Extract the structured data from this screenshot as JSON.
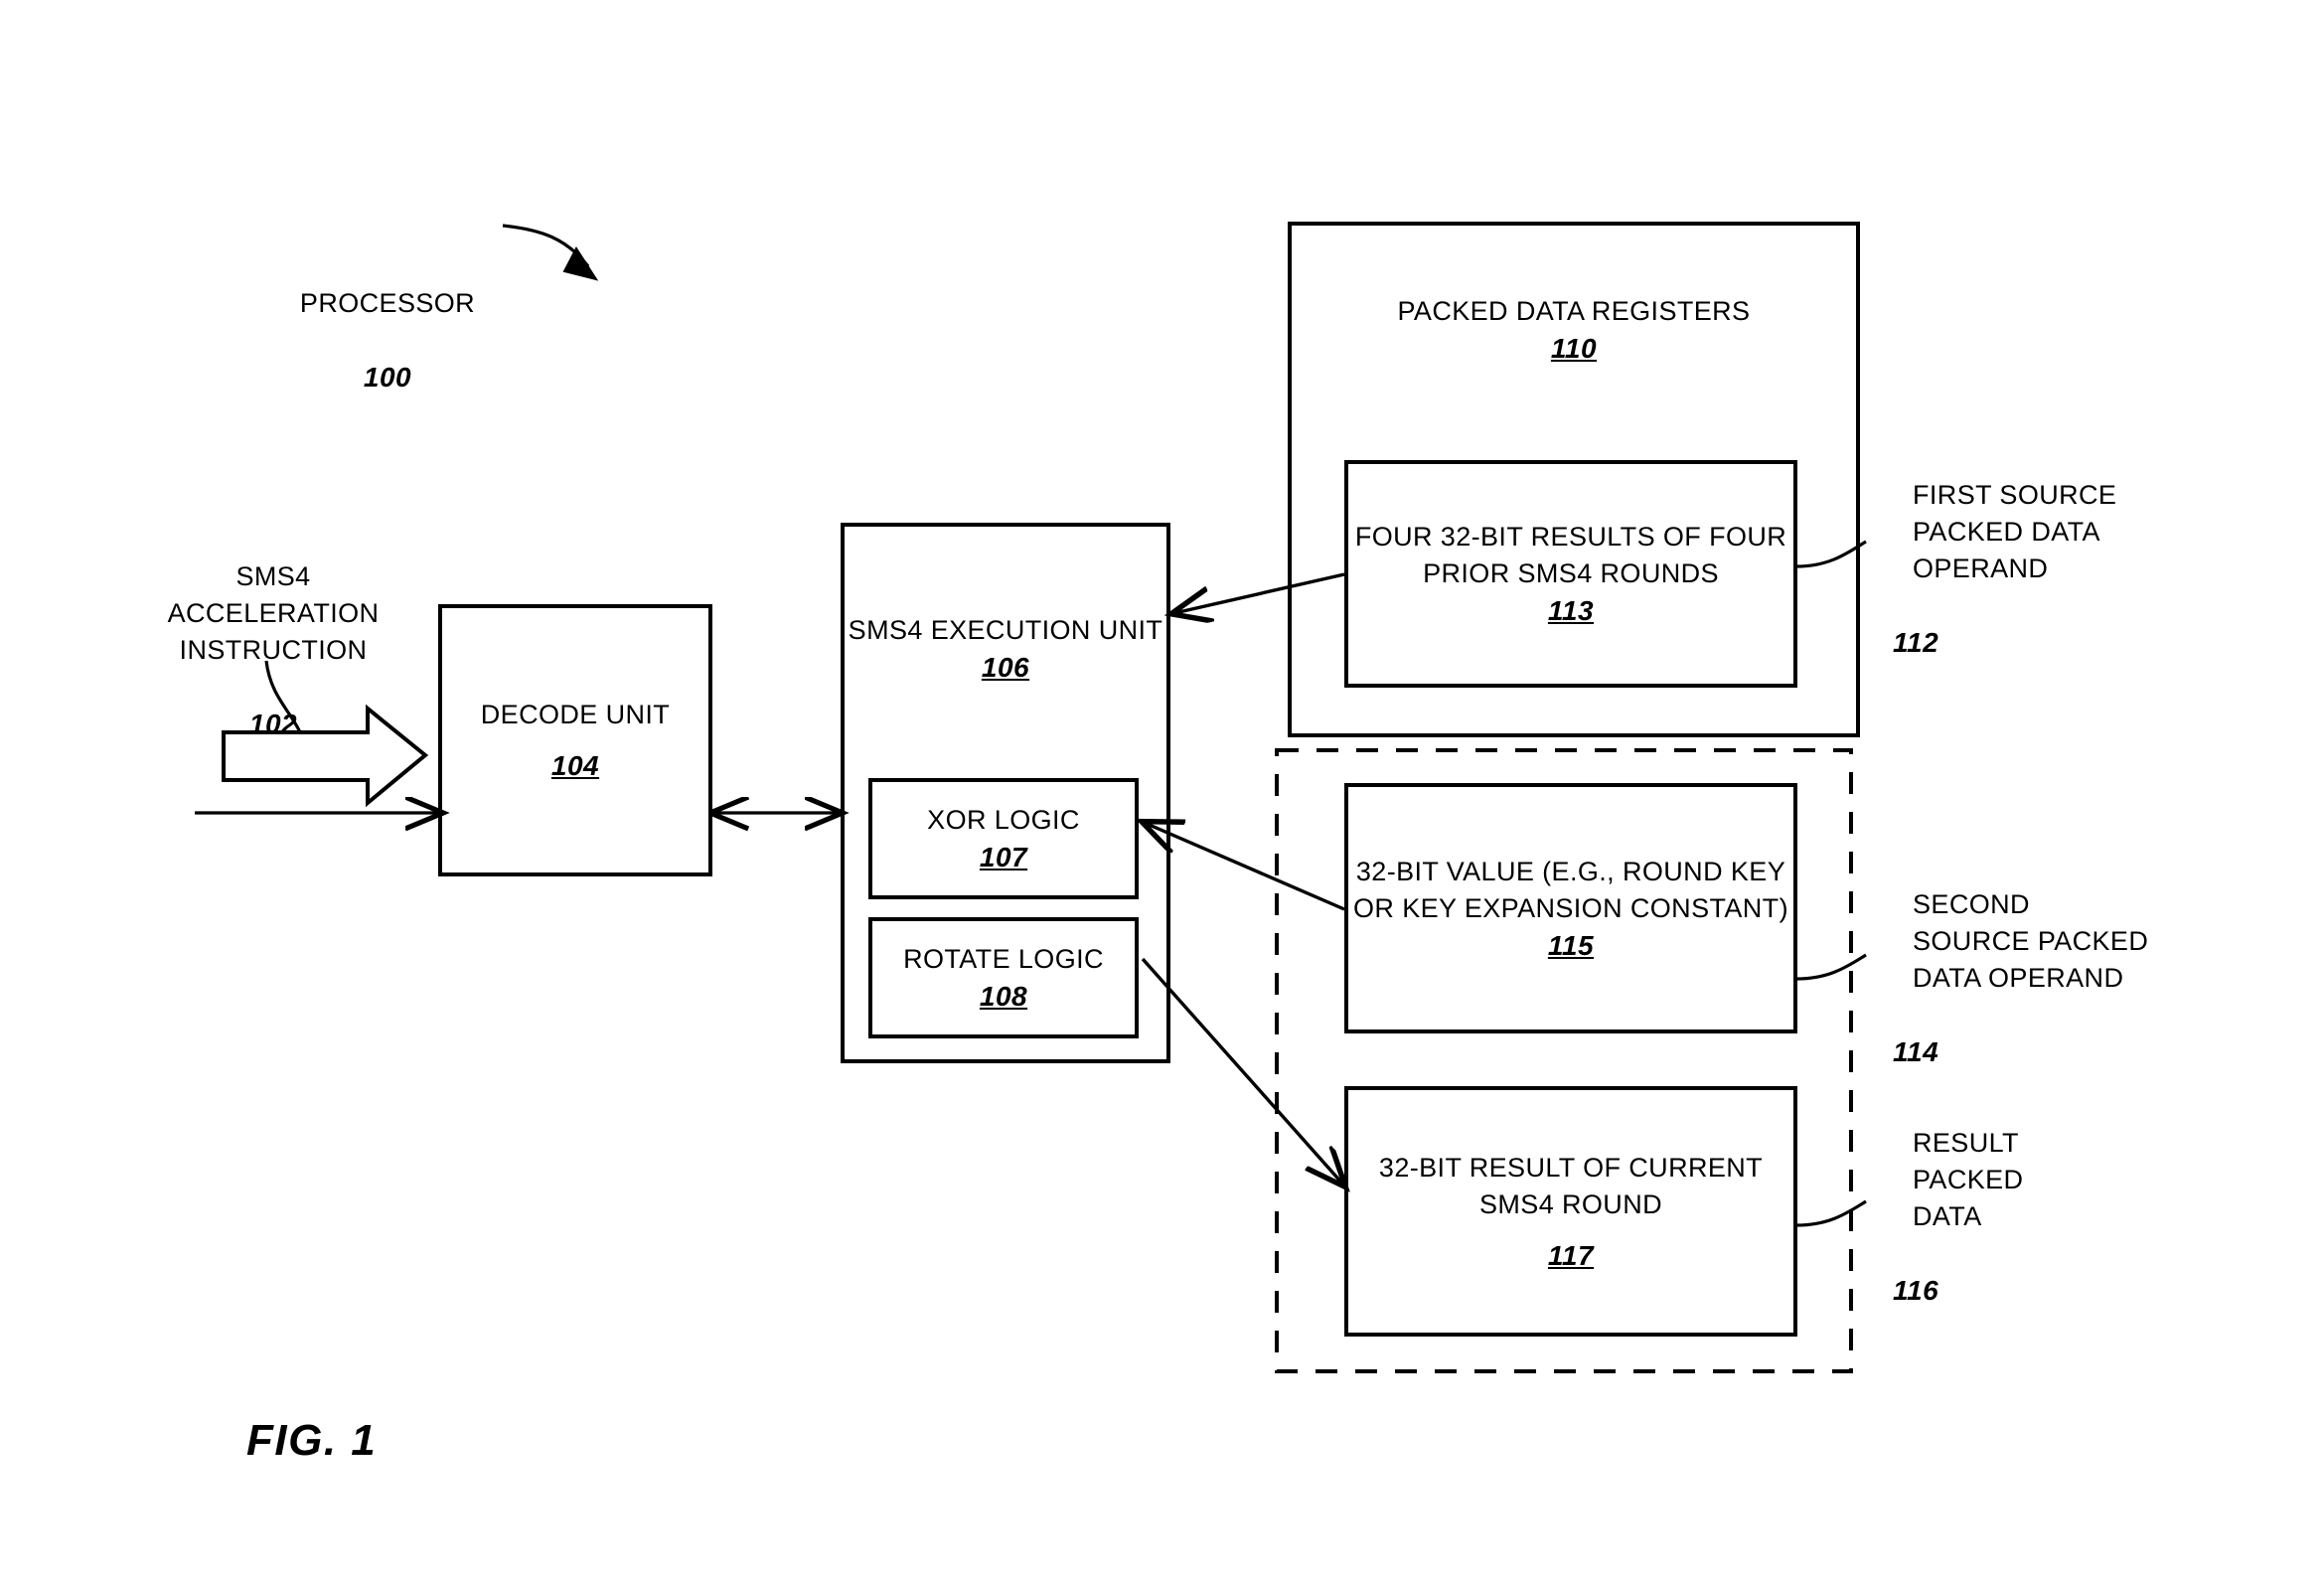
{
  "figure": {
    "caption": "FIG. 1",
    "processor_label": "PROCESSOR",
    "processor_ref": "100"
  },
  "instruction": {
    "label": "SMS4\nACCELERATION\nINSTRUCTION",
    "ref": "102"
  },
  "decode_unit": {
    "label": "DECODE\nUNIT",
    "ref": "104"
  },
  "execution_unit": {
    "label": "SMS4\nEXECUTION\nUNIT",
    "ref": "106",
    "xor_logic": {
      "label": "XOR LOGIC",
      "ref": "107"
    },
    "rotate_logic": {
      "label": "ROTATE LOGIC",
      "ref": "108"
    }
  },
  "packed_data_registers": {
    "label": "PACKED DATA REGISTERS",
    "ref": "110",
    "boxes": [
      {
        "label": "FOUR 32-BIT RESULTS\nOF FOUR PRIOR SMS4\nROUNDS",
        "ref": "113"
      },
      {
        "label": "32-BIT VALUE\n(E.G., ROUND KEY OR\nKEY EXPANSION\nCONSTANT)",
        "ref": "115"
      },
      {
        "label": "32-BIT RESULT OF\nCURRENT SMS4 ROUND",
        "ref": "117"
      }
    ]
  },
  "operand_labels": [
    {
      "label": "FIRST SOURCE\nPACKED DATA\nOPERAND",
      "ref": "112"
    },
    {
      "label": "SECOND\nSOURCE PACKED\nDATA OPERAND",
      "ref": "114"
    },
    {
      "label": "RESULT\nPACKED\nDATA",
      "ref": "116"
    }
  ],
  "colors": {
    "ink": "#000000",
    "paper": "#ffffff"
  }
}
